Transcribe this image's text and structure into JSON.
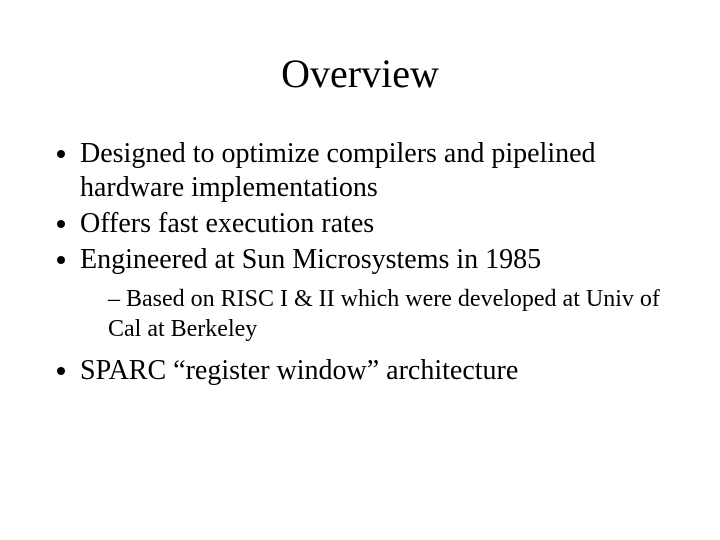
{
  "title": "Overview",
  "bullets": [
    "Designed to optimize compilers and pipelined hardware implementations",
    "Offers fast execution rates",
    "Engineered at Sun Microsystems in 1985",
    "SPARC “register window” architecture"
  ],
  "subbullets_after_2": [
    "Based on RISC I & II which were developed at Univ of Cal at Berkeley"
  ]
}
